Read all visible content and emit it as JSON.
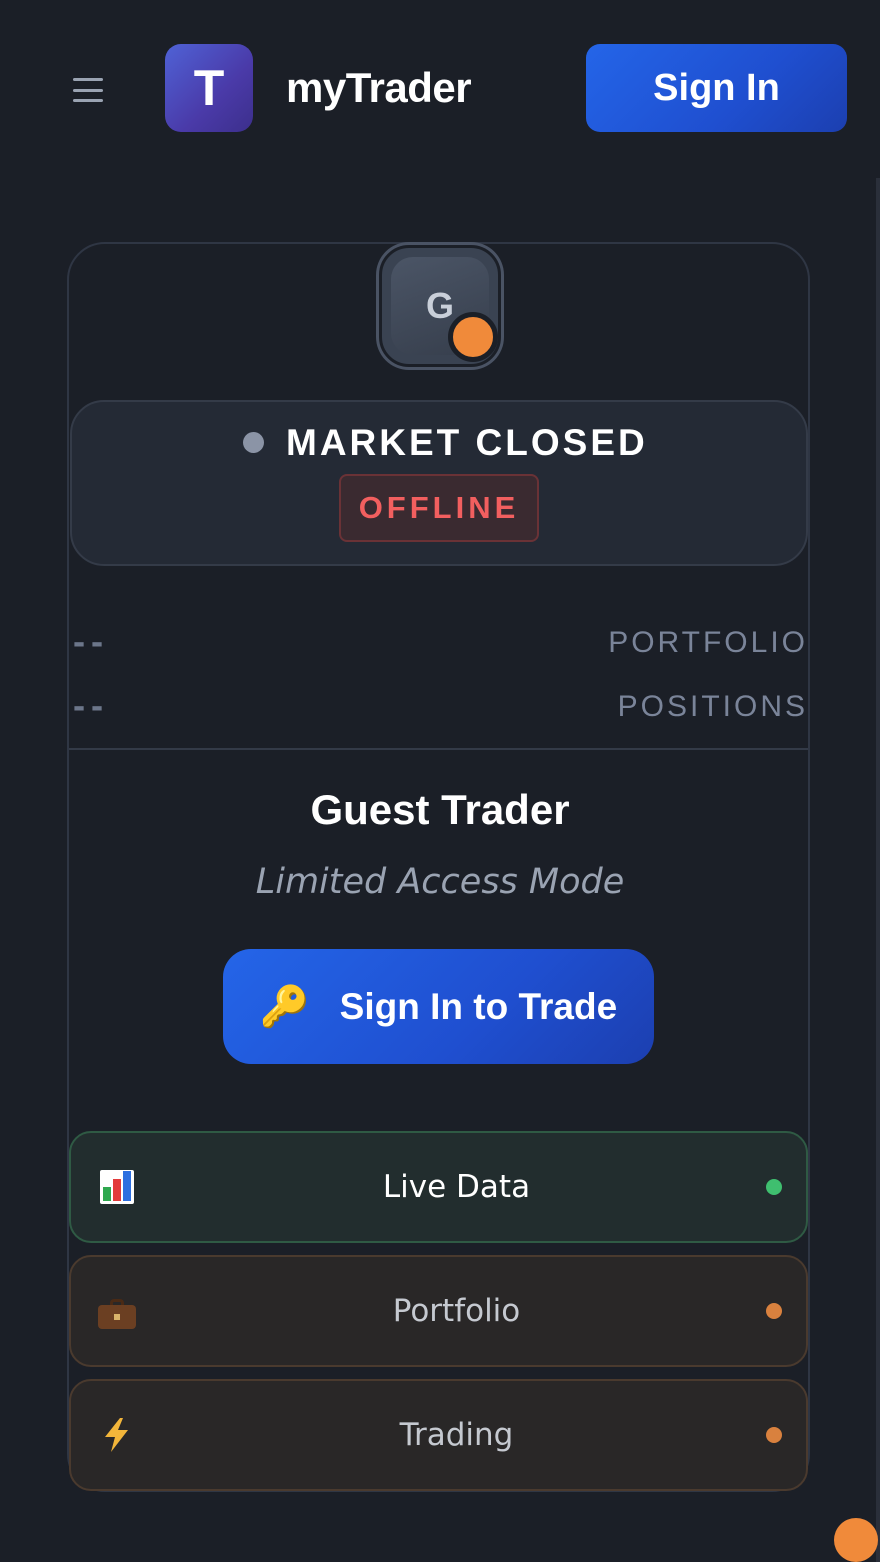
{
  "header": {
    "logo_letter": "T",
    "app_title": "myTrader",
    "signin_label": "Sign In"
  },
  "profile": {
    "avatar_letter": "G",
    "status_dot_color": "#f08a3a"
  },
  "market": {
    "status": "MARKET CLOSED",
    "badge": "OFFLINE",
    "dot_color": "#8b94a6"
  },
  "stats": [
    {
      "value": "--",
      "label": "PORTFOLIO"
    },
    {
      "value": "--",
      "label": "POSITIONS"
    }
  ],
  "user": {
    "name": "Guest Trader",
    "mode": "Limited Access Mode"
  },
  "cta": {
    "icon": "key-icon",
    "label": "Sign In to Trade"
  },
  "features": [
    {
      "icon": "bar-chart-icon",
      "label": "Live Data",
      "status_color": "#3fbf6f"
    },
    {
      "icon": "briefcase-icon",
      "label": "Portfolio",
      "status_color": "#d9813e"
    },
    {
      "icon": "lightning-icon",
      "label": "Trading",
      "status_color": "#d9813e"
    }
  ],
  "colors": {
    "background": "#1b1f27",
    "accent": "#2465e8",
    "offline": "#f25f5f"
  }
}
